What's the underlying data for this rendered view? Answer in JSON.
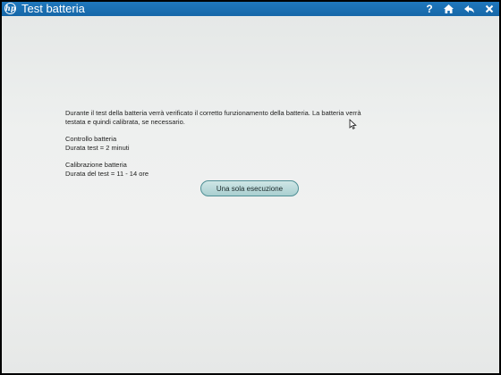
{
  "header": {
    "logo_text": "hp",
    "title": "Test batteria",
    "icons": [
      "help-icon",
      "home-icon",
      "back-icon",
      "close-icon"
    ],
    "help_glyph": "?"
  },
  "main": {
    "description_line1": "Durante il test della batteria verrà verificato il corretto funzionamento della batteria. La batteria verrà",
    "description_line2": "testata e quindi calibrata, se necessario.",
    "check_title": "Controllo batteria",
    "check_duration": "Durata test = 2 minuti",
    "calibration_title": "Calibrazione batteria",
    "calibration_duration": "Durata del test = 11 - 14 ore",
    "run_button_label": "Una sola esecuzione"
  },
  "colors": {
    "titlebar": "#1667a8",
    "button_fill": "#b8d8d8",
    "background": "#eef0ef"
  }
}
